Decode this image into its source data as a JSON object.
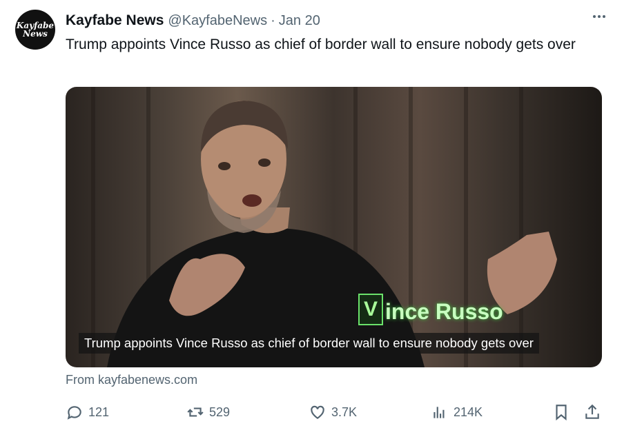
{
  "tweet": {
    "avatar_text_line1": "Kayfabe",
    "avatar_text_line2": "News",
    "display_name": "Kayfabe News",
    "handle": "@KayfabeNews",
    "separator": "·",
    "date": "Jan 20",
    "text": "Trump appoints Vince Russo as chief of border wall to ensure nobody gets over"
  },
  "media": {
    "caption": "Trump appoints Vince Russo as chief of border wall to ensure nobody gets over",
    "lower_third_letter": "V",
    "lower_third_name": "ince Russo"
  },
  "source": "From kayfabenews.com",
  "actions": {
    "replies": "121",
    "reposts": "529",
    "likes": "3.7K",
    "views": "214K"
  },
  "icons": [
    "more-icon",
    "reply-icon",
    "repost-icon",
    "like-icon",
    "views-icon",
    "bookmark-icon",
    "share-icon"
  ],
  "colors": {
    "text": "#0f1419",
    "secondary": "#536471",
    "background": "#ffffff"
  }
}
